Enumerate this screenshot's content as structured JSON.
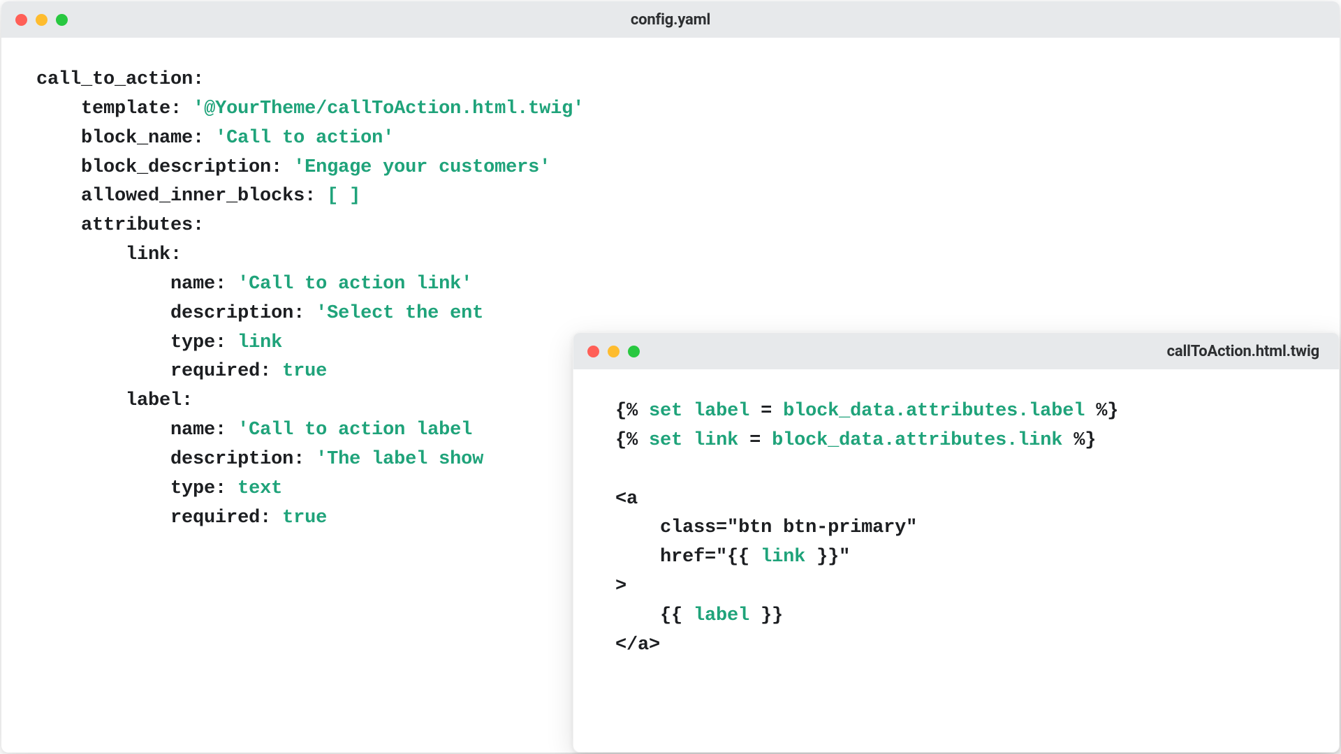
{
  "colors": {
    "titlebar": "#e7e9eb",
    "red": "#ff5f57",
    "yellow": "#febc2e",
    "green": "#28c840",
    "string": "#1fa37a",
    "text": "#1c1e21"
  },
  "window_a": {
    "title": "config.yaml",
    "code": {
      "l1_key": "call_to_action:",
      "l2_key": "template:",
      "l2_val": "'@YourTheme/callToAction.html.twig'",
      "l3_key": "block_name:",
      "l3_val": "'Call to action'",
      "l4_key": "block_description:",
      "l4_val": "'Engage your customers'",
      "l5_key": "allowed_inner_blocks:",
      "l5_val": "[ ]",
      "l6_key": "attributes:",
      "l7_key": "link:",
      "l8_key": "name:",
      "l8_val": "'Call to action link'",
      "l9_key": "description:",
      "l9_val": "'Select the ent",
      "l10_key": "type:",
      "l10_val": "link",
      "l11_key": "required:",
      "l11_val": "true",
      "l12_key": "label:",
      "l13_key": "name:",
      "l13_val": "'Call to action label",
      "l14_key": "description:",
      "l14_val": "'The label show",
      "l15_key": "type:",
      "l15_val": "text",
      "l16_key": "required:",
      "l16_val": "true"
    }
  },
  "window_b": {
    "title": "callToAction.html.twig",
    "code": {
      "l1_open": "{%",
      "l1_kw": "set",
      "l1_var": "label",
      "l1_eq": "=",
      "l1_expr": "block_data.attributes.label",
      "l1_close": "%}",
      "l2_open": "{%",
      "l2_kw": "set",
      "l2_var": "link",
      "l2_eq": "=",
      "l2_expr": "block_data.attributes.link",
      "l2_close": "%}",
      "l4": "<a",
      "l5_attr": "class=",
      "l5_q1": "\"",
      "l5_val": "btn btn-primary",
      "l5_q2": "\"",
      "l6_attr": "href=",
      "l6_q1": "\"",
      "l6_eo": "{{ ",
      "l6_var": "link",
      "l6_ec": " }}",
      "l6_q2": "\"",
      "l7": ">",
      "l8_eo": "{{ ",
      "l8_var": "label",
      "l8_ec": " }}",
      "l9": "</a>"
    }
  }
}
